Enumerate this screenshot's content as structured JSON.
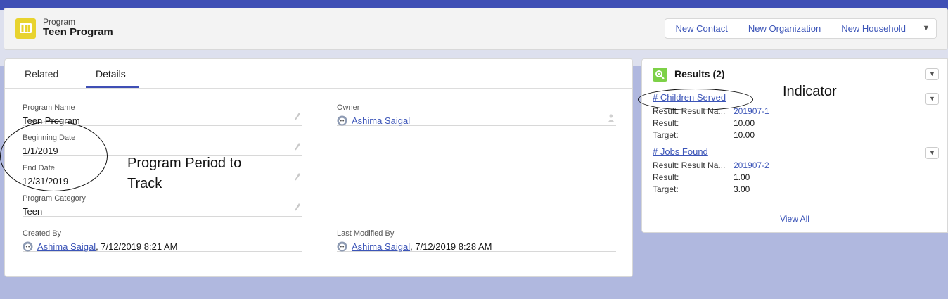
{
  "header": {
    "object_type": "Program",
    "record_title": "Teen Program",
    "icon": "book-icon",
    "actions": [
      "New Contact",
      "New Organization",
      "New Household"
    ],
    "more_actions_icon": "chevron-down-icon"
  },
  "tabs": [
    {
      "label": "Related",
      "active": false
    },
    {
      "label": "Details",
      "active": true
    }
  ],
  "details": {
    "program_name": {
      "label": "Program Name",
      "value": "Teen Program"
    },
    "beginning_date": {
      "label": "Beginning Date",
      "value": "1/1/2019"
    },
    "end_date": {
      "label": "End Date",
      "value": "12/31/2019"
    },
    "program_category": {
      "label": "Program Category",
      "value": "Teen"
    },
    "owner": {
      "label": "Owner",
      "value": "Ashima Saigal"
    },
    "created_by": {
      "label": "Created By",
      "user": "Ashima Saigal",
      "timestamp": ", 7/12/2019 8:21 AM"
    },
    "last_modified_by": {
      "label": "Last Modified By",
      "user": "Ashima Saigal",
      "timestamp": ", 7/12/2019 8:28 AM"
    }
  },
  "annotations": {
    "program_period_line1": "Program Period to",
    "program_period_line2": "Track",
    "indicator": "Indicator"
  },
  "results": {
    "title": "Results (2)",
    "icon": "results-icon",
    "items": [
      {
        "name": "# Children Served",
        "result_name_label": "Result: Result Na...",
        "result_name_value": "201907-1",
        "result_label": "Result:",
        "result_value": "10.00",
        "target_label": "Target:",
        "target_value": "10.00"
      },
      {
        "name": "# Jobs Found",
        "result_name_label": "Result: Result Na...",
        "result_name_value": "201907-2",
        "result_label": "Result:",
        "result_value": "1.00",
        "target_label": "Target:",
        "target_value": "3.00"
      }
    ],
    "view_all": "View All"
  },
  "colors": {
    "brand_blue": "#3f4fb5",
    "link_blue": "#3c55b8",
    "program_icon_yellow": "#e8d32e",
    "results_icon_green": "#7dd147"
  }
}
